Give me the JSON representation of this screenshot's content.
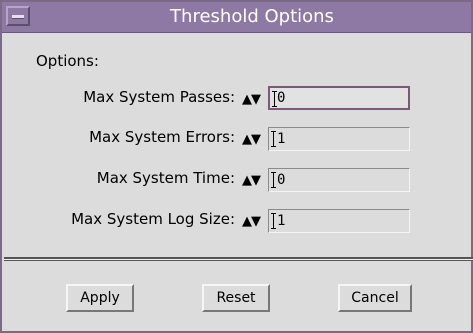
{
  "window": {
    "title": "Threshold Options"
  },
  "options_label": "Options:",
  "rows": [
    {
      "label": "Max System Passes:",
      "spinner": "▲▼",
      "value": "0"
    },
    {
      "label": "Max System Errors:",
      "spinner": "▲▼",
      "value": "1"
    },
    {
      "label": "Max System Time:",
      "spinner": "▲▼",
      "value": "0"
    },
    {
      "label": "Max System Log Size:",
      "spinner": "▲▼",
      "value": "1"
    }
  ],
  "buttons": {
    "apply": "Apply",
    "reset": "Reset",
    "cancel": "Cancel"
  },
  "colors": {
    "titlebar": "#8e78a4",
    "focus_border": "#7a5a78",
    "background": "#dcdcdc"
  }
}
